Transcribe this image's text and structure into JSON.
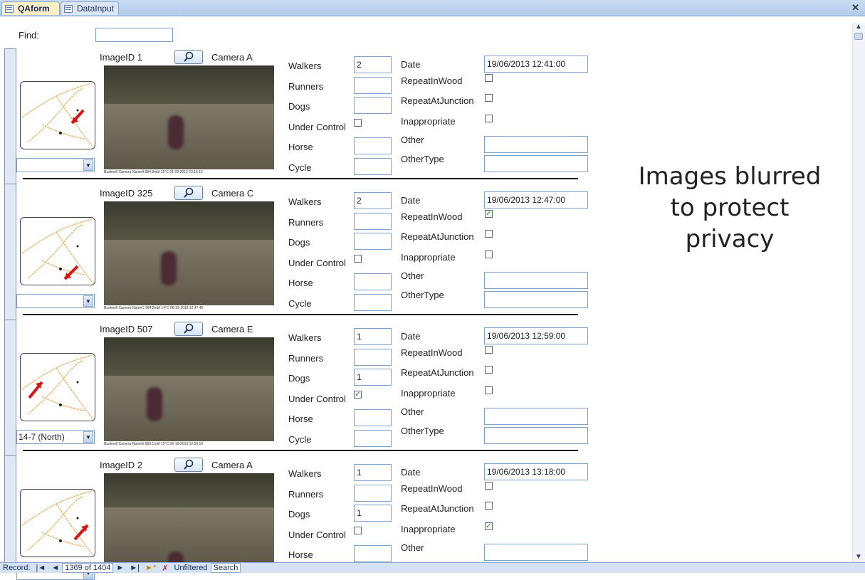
{
  "tabs": [
    {
      "label": "QAform",
      "active": true
    },
    {
      "label": "DataInput",
      "active": false
    }
  ],
  "find": {
    "label": "Find:",
    "value": ""
  },
  "labels": {
    "walkers": "Walkers",
    "runners": "Runners",
    "dogs": "Dogs",
    "under_control": "Under Control",
    "horse": "Horse",
    "cycle": "Cycle",
    "date": "Date",
    "repeat_in_wood": "RepeatInWood",
    "repeat_at_junction": "RepeatAtJunction",
    "inappropriate": "Inappropriate",
    "other": "Other",
    "other_type": "OtherType"
  },
  "records": [
    {
      "image_id": "ImageID 1",
      "camera": "Camera  A",
      "direction": "",
      "walkers": "2",
      "runners": "",
      "dogs": "",
      "horse": "",
      "cycle": "",
      "date": "19/06/2013 12:41:00",
      "repeat_in_wood": false,
      "repeat_at_junction": false,
      "inappropriate": false,
      "under_control": false,
      "other": "",
      "other_type": "",
      "photo_caption": "Bushnell  Camera NameA 984.8mbf 15°C   01-02-2012 23:16:15"
    },
    {
      "image_id": "ImageID 325",
      "camera": "Camera  C",
      "direction": "",
      "walkers": "2",
      "runners": "",
      "dogs": "",
      "horse": "",
      "cycle": "",
      "date": "19/06/2013 12:47:00",
      "repeat_in_wood": true,
      "repeat_at_junction": false,
      "inappropriate": false,
      "under_control": false,
      "other": "",
      "other_type": "",
      "photo_caption": "Bushnell  Camera NameC 984.2mbf 14°C   06-19-2013 12:47:45"
    },
    {
      "image_id": "ImageID 507",
      "camera": "Camera  E",
      "direction": "14-7 (North)",
      "walkers": "1",
      "runners": "",
      "dogs": "1",
      "horse": "",
      "cycle": "",
      "date": "19/06/2013 12:59:00",
      "repeat_in_wood": false,
      "repeat_at_junction": false,
      "inappropriate": false,
      "under_control": true,
      "other": "",
      "other_type": "",
      "photo_caption": "Bushnell  Camera NameE 983.1mbf 15°C   06-19-2013 12:59:10"
    },
    {
      "image_id": "ImageID 2",
      "camera": "Camera  A",
      "direction": "",
      "walkers": "1",
      "runners": "",
      "dogs": "1",
      "horse": "",
      "cycle": "",
      "date": "19/06/2013 13:18:00",
      "repeat_in_wood": false,
      "repeat_at_junction": false,
      "inappropriate": true,
      "under_control": false,
      "other": "",
      "other_type": "",
      "photo_caption": ""
    }
  ],
  "status": {
    "record_label": "Record:",
    "record_value": "1369 of 1404",
    "filter": "Unfiltered",
    "search": "Search"
  },
  "overlay": {
    "line1": "Images blurred",
    "line2": "to protect",
    "line3": "privacy"
  },
  "colors": {
    "accent": "#8aa8cf",
    "check": "#1a8a1a",
    "arrow": "#e01010"
  }
}
